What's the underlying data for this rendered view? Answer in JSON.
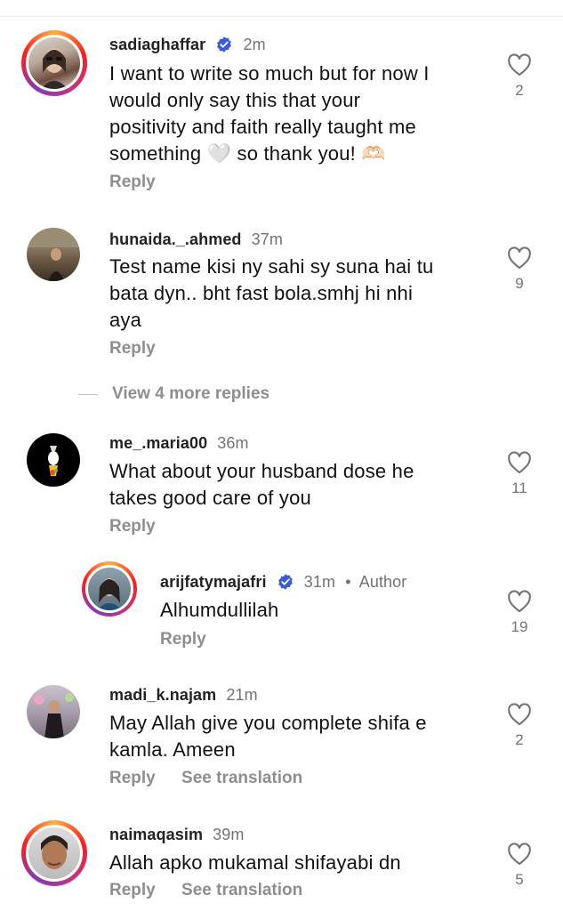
{
  "comments": [
    {
      "username": "sadiaghaffar",
      "time": "2m",
      "verified": true,
      "text_lines": [
        "I want to write so much but for now I",
        "would only say this that your",
        "positivity and faith really taught me",
        "something 🤍 so thank you! 🫶🏻"
      ],
      "reply_label": "Reply",
      "likes": "2"
    },
    {
      "username": "hunaida._.ahmed",
      "time": "37m",
      "text_lines": [
        "Test name kisi ny sahi sy suna hai tu",
        "bata dyn.. bht fast bola.smhj hi nhi",
        "aya"
      ],
      "reply_label": "Reply",
      "likes": "9"
    },
    {
      "username": "me_.maria00",
      "time": "36m",
      "text_lines": [
        "What about your husband dose he",
        "takes good care of you"
      ],
      "reply_label": "Reply",
      "likes": "11"
    },
    {
      "username": "arijfatymajafri",
      "time": "31m",
      "verified": true,
      "author_label": "Author",
      "text_lines": [
        "Alhumdullilah"
      ],
      "reply_label": "Reply",
      "likes": "19"
    },
    {
      "username": "madi_k.najam",
      "time": "21m",
      "text_lines": [
        "May Allah give you complete shifa e",
        "kamla. Ameen"
      ],
      "reply_label": "Reply",
      "translation_label": "See translation",
      "likes": "2"
    },
    {
      "username": "naimaqasim",
      "time": "39m",
      "text_lines": [
        "Allah apko mukamal shifayabi dn"
      ],
      "reply_label": "Reply",
      "translation_label": "See translation",
      "likes": "5"
    }
  ],
  "view_more_replies": "View 4 more replies",
  "icons": {
    "like": "heart-outline-icon",
    "verified": "verified-badge-icon"
  },
  "colors": {
    "verified_blue": "#3b5bdb",
    "muted": "#8e8e8e"
  }
}
